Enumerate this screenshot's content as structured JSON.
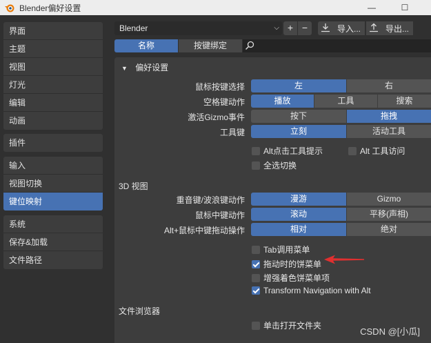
{
  "window": {
    "title": "Blender偏好设置",
    "minimize": "—",
    "maximize": "☐"
  },
  "sidebar": {
    "group1": [
      "界面",
      "主题",
      "视图",
      "灯光",
      "编辑",
      "动画"
    ],
    "group2": [
      "插件"
    ],
    "group3": [
      "输入",
      "视图切换",
      "键位映射"
    ],
    "group4": [
      "系统",
      "保存&加载",
      "文件路径"
    ],
    "active": "键位映射"
  },
  "toolbar": {
    "preset": "Blender",
    "add_label": "+",
    "remove_label": "−",
    "import_label": "导入...",
    "export_label": "导出..."
  },
  "tabs": {
    "name_tab": "名称",
    "keybind_tab": "按键绑定"
  },
  "prefs": {
    "header": "偏好设置",
    "mouse_select": {
      "label": "鼠标按键选择",
      "options": [
        "左",
        "右"
      ],
      "selected": 0
    },
    "spacebar": {
      "label": "空格键动作",
      "options": [
        "播放",
        "工具",
        "搜索"
      ],
      "selected": 0
    },
    "gizmo": {
      "label": "激活Gizmo事件",
      "options": [
        "按下",
        "拖拽"
      ],
      "selected": 1
    },
    "tool_keys": {
      "label": "工具键",
      "options": [
        "立刻",
        "活动工具"
      ],
      "selected": 0
    },
    "alt_tooltip": {
      "label": "Alt点击工具提示",
      "checked": false
    },
    "alt_tool_access": {
      "label": "Alt 工具访问",
      "checked": false
    },
    "select_all_toggle": {
      "label": "全选切换",
      "checked": false
    }
  },
  "view3d": {
    "title": "3D 视图",
    "tilde": {
      "label": "重音键/波浪键动作",
      "options": [
        "漫游",
        "Gizmo"
      ],
      "selected": 0
    },
    "middle_mouse": {
      "label": "鼠标中键动作",
      "options": [
        "滚动",
        "平移(声相)"
      ],
      "selected": 0
    },
    "alt_middle_drag": {
      "label": "Alt+鼠标中键拖动操作",
      "options": [
        "相对",
        "绝对"
      ],
      "selected": 0
    },
    "tab_pie": {
      "label": "Tab调用菜单",
      "checked": false
    },
    "pie_on_drag": {
      "label": "拖动时的饼菜单",
      "checked": true
    },
    "extra_shading_pie": {
      "label": "增强着色饼菜单项",
      "checked": false
    },
    "transform_nav_alt": {
      "label": "Transform Navigation with Alt",
      "checked": true
    }
  },
  "file_browser": {
    "title": "文件浏览器",
    "single_click": {
      "label": "单击打开文件夹",
      "checked": false
    }
  },
  "colors": {
    "accent": "#4772b3",
    "annotation_arrow": "#e03030"
  },
  "watermark": "CSDN @[小瓜]"
}
